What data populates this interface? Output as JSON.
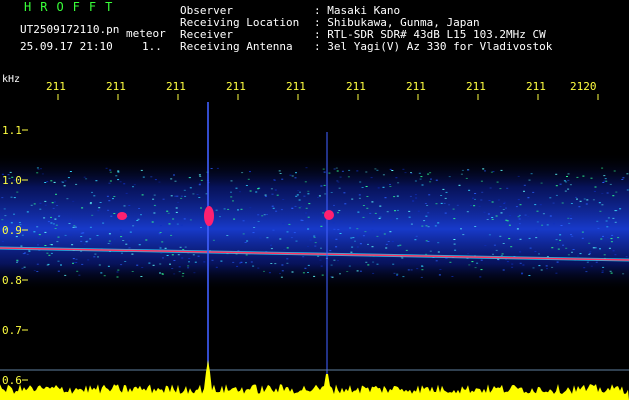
{
  "header": {
    "logo": "HROFFT",
    "filename": "UT2509172110.pn",
    "tag": "meteor",
    "datetime": "25.09.17 21:10",
    "count": "1..",
    "info": [
      {
        "label": "Observer",
        "value": ": Masaki Kano"
      },
      {
        "label": "Receiving Location",
        "value": ": Shibukawa, Gunma, Japan"
      },
      {
        "label": "Receiver",
        "value": ": RTL-SDR SDR# 43dB L15 103.2MHz CW"
      },
      {
        "label": "Receiving Antenna",
        "value": ": 3el Yagi(V) Az 330 for Vladivostok"
      }
    ]
  },
  "plot": {
    "y_unit": "kHz",
    "x_ticks": [
      "211",
      "211",
      "211",
      "211",
      "211",
      "211",
      "211",
      "211",
      "211",
      "2120"
    ],
    "y_ticks": [
      "1.1",
      "1.0",
      "0.9",
      "0.8",
      "0.7",
      "0.6"
    ],
    "colors": {
      "tick": "#ffff40",
      "noise": "#1a3fd0",
      "trace": "#ff3060",
      "power": "#ffff00"
    }
  }
}
